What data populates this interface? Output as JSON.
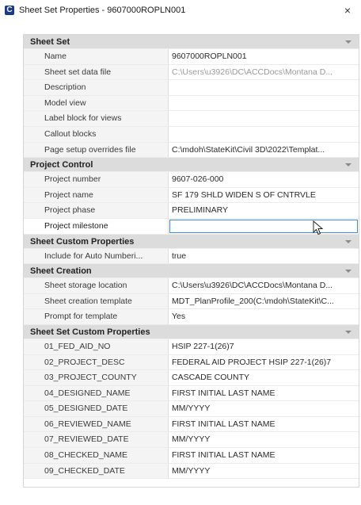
{
  "window": {
    "title": "Sheet Set Properties - 9607000ROPLN001",
    "app_icon_letter": "C",
    "close_label": "×"
  },
  "sections": [
    {
      "id": "sheet-set",
      "header": "Sheet Set",
      "rows": [
        {
          "label": "Name",
          "value": "9607000ROPLN001",
          "greyed": false
        },
        {
          "label": "Sheet set data file",
          "value": "C:\\Users\\u3926\\DC\\ACCDocs\\Montana  D...",
          "greyed": true
        },
        {
          "label": "Description",
          "value": "",
          "greyed": false
        },
        {
          "label": "Model view",
          "value": "",
          "greyed": false
        },
        {
          "label": "Label block for views",
          "value": "",
          "greyed": false
        },
        {
          "label": "Callout blocks",
          "value": "",
          "greyed": false
        },
        {
          "label": "Page setup overrides file",
          "value": "C:\\mdoh\\StateKit\\Civil  3D\\2022\\Templat...",
          "greyed": false
        }
      ]
    },
    {
      "id": "project-control",
      "header": "Project Control",
      "rows": [
        {
          "label": "Project number",
          "value": "9607-026-000",
          "greyed": false
        },
        {
          "label": "Project name",
          "value": "SF 179 SHLD WIDEN S OF CNTRVLE",
          "greyed": false
        },
        {
          "label": "Project phase",
          "value": "PRELIMINARY",
          "greyed": false
        },
        {
          "label": "Project milestone",
          "value": "",
          "greyed": false,
          "active": true
        }
      ]
    },
    {
      "id": "sheet-custom-properties",
      "header": "Sheet Custom Properties",
      "rows": [
        {
          "label": "Include for Auto Numberi...",
          "value": "true",
          "greyed": false
        }
      ]
    },
    {
      "id": "sheet-creation",
      "header": "Sheet Creation",
      "rows": [
        {
          "label": "Sheet storage location",
          "value": "C:\\Users\\u3926\\DC\\ACCDocs\\Montana  D...",
          "greyed": false
        },
        {
          "label": "Sheet creation template",
          "value": "MDT_PlanProfile_200(C:\\mdoh\\StateKit\\C...",
          "greyed": false
        },
        {
          "label": "Prompt for template",
          "value": "Yes",
          "greyed": false
        }
      ]
    },
    {
      "id": "sheet-set-custom-properties",
      "header": "Sheet Set Custom Properties",
      "rows": [
        {
          "label": "01_FED_AID_NO",
          "value": "HSIP 227-1(26)7",
          "greyed": false
        },
        {
          "label": "02_PROJECT_DESC",
          "value": "FEDERAL AID PROJECT HSIP 227-1(26)7",
          "greyed": false
        },
        {
          "label": "03_PROJECT_COUNTY",
          "value": "CASCADE COUNTY",
          "greyed": false
        },
        {
          "label": "04_DESIGNED_NAME",
          "value": "FIRST INITIAL LAST NAME",
          "greyed": false
        },
        {
          "label": "05_DESIGNED_DATE",
          "value": "MM/YYYY",
          "greyed": false
        },
        {
          "label": "06_REVIEWED_NAME",
          "value": "FIRST INITIAL LAST NAME",
          "greyed": false
        },
        {
          "label": "07_REVIEWED_DATE",
          "value": "MM/YYYY",
          "greyed": false
        },
        {
          "label": "08_CHECKED_NAME",
          "value": "FIRST INITIAL LAST NAME",
          "greyed": false
        },
        {
          "label": "09_CHECKED_DATE",
          "value": "MM/YYYY",
          "greyed": false
        }
      ]
    }
  ],
  "icons": {
    "section_toggle": "chevron-down-icon",
    "cursor": "mouse-pointer-icon"
  }
}
